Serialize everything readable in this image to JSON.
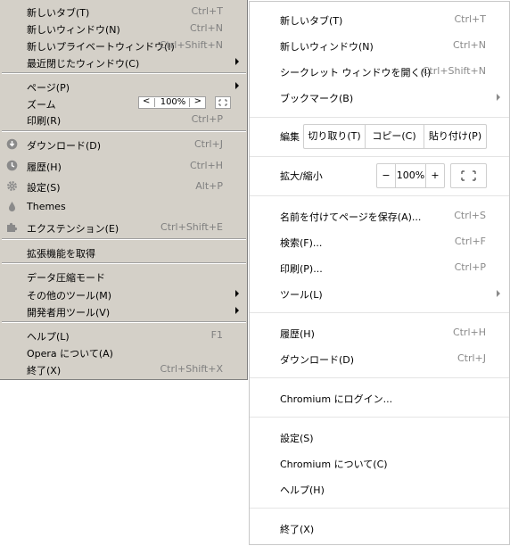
{
  "opera_menu": {
    "new_tab": {
      "label": "新しいタブ(T)",
      "shortcut": "Ctrl+T"
    },
    "new_window": {
      "label": "新しいウィンドウ(N)",
      "shortcut": "Ctrl+N"
    },
    "new_private": {
      "label": "新しいプライベートウィンドウ(I)",
      "shortcut": "Ctrl+Shift+N"
    },
    "recently_closed": {
      "label": "最近閉じたウィンドウ(C)"
    },
    "page": {
      "label": "ページ(P)"
    },
    "zoom": {
      "label": "ズーム",
      "value": "100%",
      "prev": "<",
      "next": ">"
    },
    "print": {
      "label": "印刷(R)",
      "shortcut": "Ctrl+P"
    },
    "downloads": {
      "label": "ダウンロード(D)",
      "shortcut": "Ctrl+J"
    },
    "history": {
      "label": "履歴(H)",
      "shortcut": "Ctrl+H"
    },
    "settings": {
      "label": "設定(S)",
      "shortcut": "Alt+P"
    },
    "themes": {
      "label": "Themes"
    },
    "extensions": {
      "label": "エクステンション(E)",
      "shortcut": "Ctrl+Shift+E"
    },
    "get_extensions": {
      "label": "拡張機能を取得"
    },
    "data_saver": {
      "label": "データ圧縮モード"
    },
    "other_tools": {
      "label": "その他のツール(M)"
    },
    "developer_tools": {
      "label": "開発者用ツール(V)"
    },
    "help": {
      "label": "ヘルプ(L)",
      "shortcut": "F1"
    },
    "about": {
      "label": "Opera について(A)"
    },
    "exit": {
      "label": "終了(X)",
      "shortcut": "Ctrl+Shift+X"
    }
  },
  "chromium_menu": {
    "new_tab": {
      "label": "新しいタブ(T)",
      "shortcut": "Ctrl+T"
    },
    "new_window": {
      "label": "新しいウィンドウ(N)",
      "shortcut": "Ctrl+N"
    },
    "incognito": {
      "label": "シークレット ウィンドウを開く(I)",
      "shortcut": "Ctrl+Shift+N"
    },
    "bookmarks": {
      "label": "ブックマーク(B)"
    },
    "edit": {
      "label": "編集",
      "cut": "切り取り(T)",
      "copy": "コピー(C)",
      "paste": "貼り付け(P)"
    },
    "zoom": {
      "label": "拡大/縮小",
      "minus": "−",
      "value": "100%",
      "plus": "+"
    },
    "save_as": {
      "label": "名前を付けてページを保存(A)...",
      "shortcut": "Ctrl+S"
    },
    "find": {
      "label": "検索(F)...",
      "shortcut": "Ctrl+F"
    },
    "print": {
      "label": "印刷(P)...",
      "shortcut": "Ctrl+P"
    },
    "tools": {
      "label": "ツール(L)"
    },
    "history": {
      "label": "履歴(H)",
      "shortcut": "Ctrl+H"
    },
    "downloads": {
      "label": "ダウンロード(D)",
      "shortcut": "Ctrl+J"
    },
    "sign_in": {
      "label": "Chromium にログイン..."
    },
    "settings": {
      "label": "設定(S)"
    },
    "about": {
      "label": "Chromium について(C)"
    },
    "help": {
      "label": "ヘルプ(H)"
    },
    "exit": {
      "label": "終了(X)"
    }
  }
}
